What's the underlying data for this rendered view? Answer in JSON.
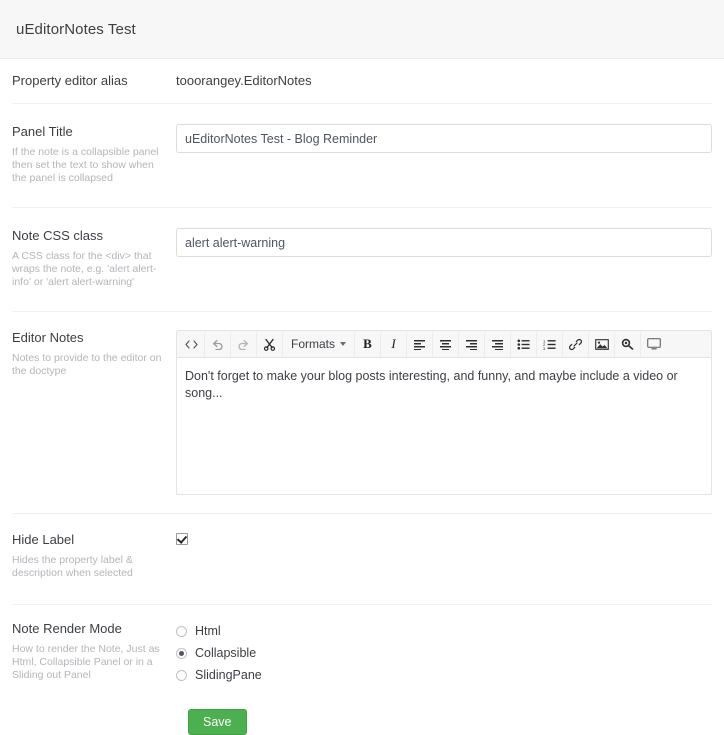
{
  "header": {
    "title": "uEditorNotes Test"
  },
  "rows": {
    "alias": {
      "label": "Property editor alias",
      "value": "tooorangey.EditorNotes"
    },
    "panel_title": {
      "label": "Panel Title",
      "description": "If the note is a collapsible panel then set the text to show when the panel is collapsed",
      "value": "uEditorNotes Test - Blog Reminder",
      "placeholder": ""
    },
    "note_css_class": {
      "label": "Note CSS class",
      "description": "A CSS class for the <div> that wraps the note, e.g. 'alert alert-info' or 'alert alert-warning'",
      "value": "alert alert-warning",
      "placeholder": ""
    },
    "editor_notes": {
      "label": "Editor Notes",
      "description": "Notes to provide to the editor on the doctype",
      "content": "Don't forget to make your blog posts interesting, and funny, and maybe include a video or song...",
      "toolbar": {
        "source_code": "source-code-icon",
        "undo": "undo-icon",
        "redo": "redo-icon",
        "cut": "scissors-icon",
        "formats_label": "Formats",
        "bold": "B",
        "italic": "I",
        "align_left": "align-left-icon",
        "align_center": "align-center-icon",
        "align_right": "align-right-icon",
        "align_justify": "align-justify-icon",
        "bullet_list": "bullet-list-icon",
        "numbered_list": "numbered-list-icon",
        "link": "link-icon",
        "image": "image-icon",
        "macro": "macro-icon",
        "embed": "embed-icon"
      }
    },
    "hide_label": {
      "label": "Hide Label",
      "description": "Hides the property label & description when selected",
      "checked": true
    },
    "note_render_mode": {
      "label": "Note Render Mode",
      "description": "How to render the Note, Just as Html, Collapsible Panel or in a Sliding out Panel",
      "options": [
        {
          "label": "Html",
          "selected": false
        },
        {
          "label": "Collapsible",
          "selected": true
        },
        {
          "label": "SlidingPane",
          "selected": false
        }
      ]
    }
  },
  "footer": {
    "save_label": "Save"
  },
  "colors": {
    "save_green": "#4caf50",
    "header_bg": "#f7f7f7",
    "text": "#3b3f44",
    "muted": "#b5b5bb"
  }
}
